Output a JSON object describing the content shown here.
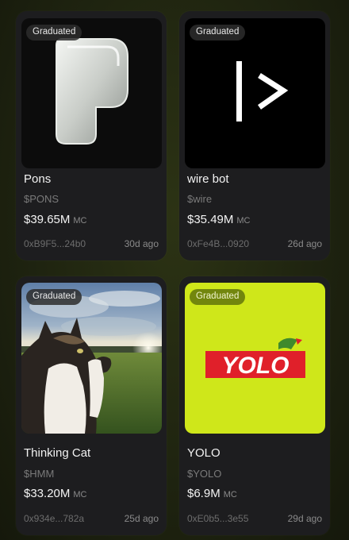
{
  "cards": [
    {
      "badge": "Graduated",
      "name": "Pons",
      "ticker": "$PONS",
      "market_cap": "$39.65M",
      "mc_label": "MC",
      "address": "0xB9F5...24b0",
      "age": "30d ago",
      "image_icon": "pons-logo-icon"
    },
    {
      "badge": "Graduated",
      "name": "wire bot",
      "ticker": "$wire",
      "market_cap": "$35.49M",
      "mc_label": "MC",
      "address": "0xFe4B...0920",
      "age": "26d ago",
      "image_icon": "wire-logo-icon"
    },
    {
      "badge": "Graduated",
      "name": "Thinking Cat",
      "ticker": "$HMM",
      "market_cap": "$33.20M",
      "mc_label": "MC",
      "address": "0x934e...782a",
      "age": "25d ago",
      "image_icon": "thinking-cat-image"
    },
    {
      "badge": "Graduated",
      "name": "YOLO",
      "ticker": "$YOLO",
      "market_cap": "$6.9M",
      "mc_label": "MC",
      "address": "0xE0b5...3e55",
      "age": "29d ago",
      "image_icon": "yolo-logo-icon",
      "logo_text": "YOLO"
    }
  ],
  "colors": {
    "page_bg": "#1f2410",
    "card_bg": "#1d1d1f",
    "yolo_bg": "#cfe71a",
    "yolo_red": "#e0202a"
  }
}
